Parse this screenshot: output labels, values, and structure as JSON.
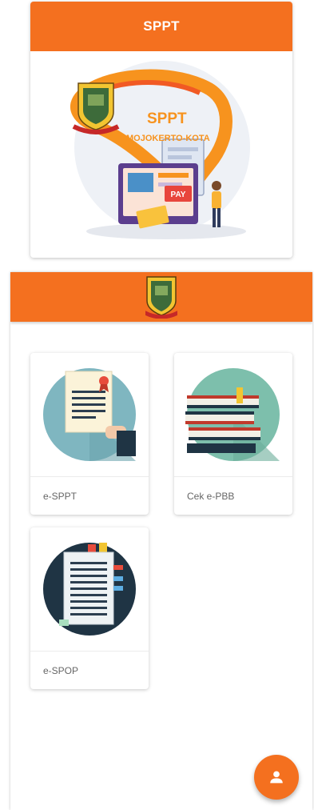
{
  "top_card": {
    "title": "SPPT",
    "banner_title": "SPPT",
    "banner_subtitle": "MOJOKERTO-KOTA",
    "pay_label": "PAY"
  },
  "menu": {
    "items": [
      {
        "label": "e-SPPT",
        "icon": "certificate-document-icon"
      },
      {
        "label": "Cek e-PBB",
        "icon": "book-stack-icon"
      },
      {
        "label": "e-SPOP",
        "icon": "clipboard-document-icon"
      }
    ]
  },
  "fab": {
    "icon": "user-icon"
  },
  "colors": {
    "accent": "#f4701f",
    "tile_teal": "#7fb6c0",
    "tile_green": "#7dbfac",
    "tile_dark": "#1f3444"
  }
}
